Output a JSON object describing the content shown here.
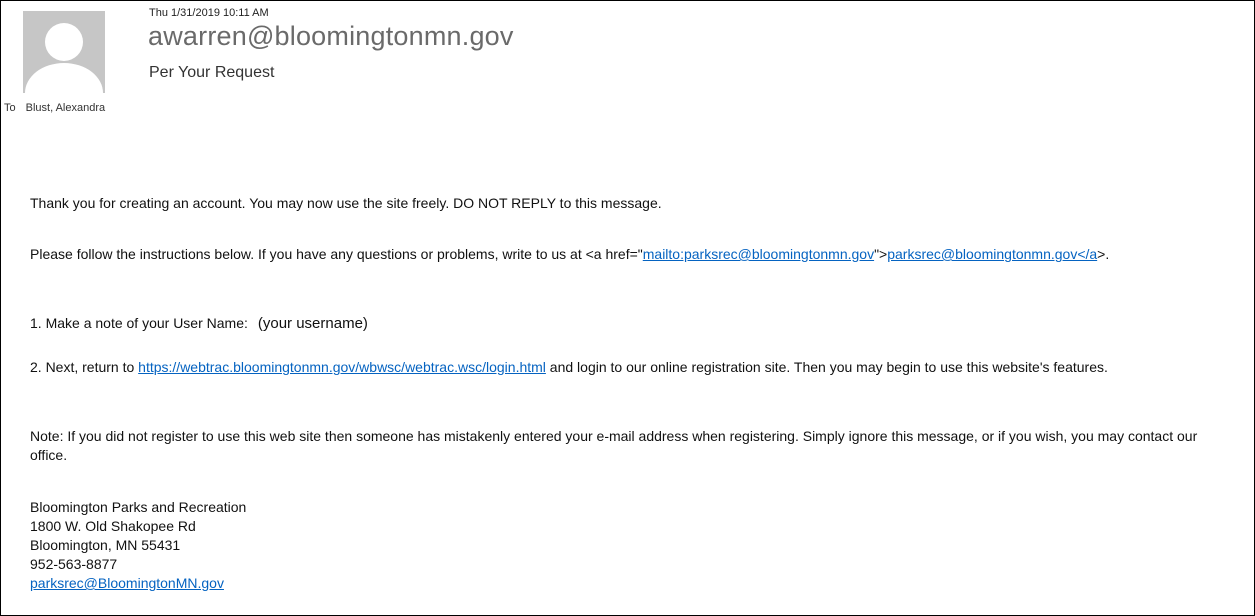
{
  "email": {
    "date": "Thu 1/31/2019 10:11 AM",
    "sender": "awarren@bloomingtonmn.gov",
    "subject": "Per Your Request",
    "to_label": "To",
    "to_name": "Blust, Alexandra"
  },
  "body": {
    "p1": "Thank you for creating an account. You may now use the site freely. DO NOT REPLY to this message.",
    "p2_prefix": "Please follow the instructions below. If you have any questions or problems, write to us at <a href=\"",
    "p2_link1": "mailto:parksrec@bloomingtonmn.gov",
    "p2_mid": "\">",
    "p2_link2": "parksrec@bloomingtonmn.gov</a",
    "p2_suffix": ">.",
    "p3_label": "1. Make a note of your User Name:",
    "p3_value": "(your username)",
    "p4_prefix": "2. Next, return to ",
    "p4_link": "https://webtrac.bloomingtonmn.gov/wbwsc/webtrac.wsc/login.html",
    "p4_suffix": " and login to our online registration site. Then you may begin to use this website's features.",
    "p5": "Note: If you did not register to use this web site then someone has mistakenly entered your e-mail address when registering. Simply ignore this message, or if you wish, you may contact our office."
  },
  "signature": {
    "org": "Bloomington Parks and Recreation",
    "street": "1800 W. Old Shakopee Rd",
    "city": "Bloomington, MN  55431",
    "phone": "952-563-8877",
    "email": "parksrec@BloomingtonMN.gov"
  },
  "colors": {
    "link": "#0563c1",
    "sender": "#6a6a6a",
    "avatar_bg": "#c6c6c6"
  }
}
